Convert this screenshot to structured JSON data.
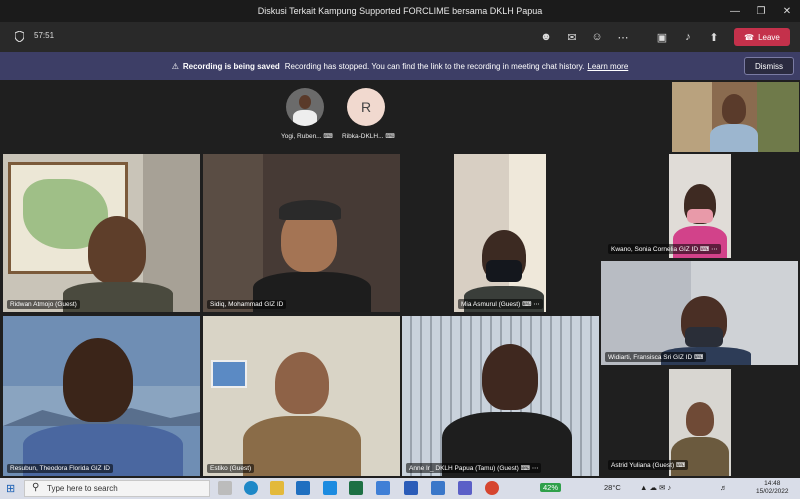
{
  "window": {
    "title": "Diskusi Terkait Kampung Supported FORCLIME bersama DKLH Papua"
  },
  "toolbar": {
    "timer": "57:51",
    "leave_label": "Leave"
  },
  "banner": {
    "bold": "Recording is being saved",
    "message": "Recording has stopped. You can find the link to the recording in meeting chat history.",
    "link": "Learn more",
    "dismiss_label": "Dismiss"
  },
  "avatars": [
    {
      "name": "Yogi, Ruben...",
      "initial": ""
    },
    {
      "name": "Ribka-DKLH...",
      "initial": "R"
    }
  ],
  "participants": {
    "ridwan": "Ridwan Atmojo (Guest)",
    "sidiq": "Sidiq, Mohammad GIZ ID",
    "mia": "Mia Asmurul (Guest)",
    "kwano": "Kwano, Sonia Cornelia GIZ ID",
    "widiarti": "Widiarti, Fransisca Sri GIZ ID",
    "resubun": "Resubun, Theodora Florida GIZ ID",
    "estiko": "Estiko (Guest)",
    "anne": "Anne Ir_ DKLH Papua (Tamu) (Guest)",
    "astrid": "Astrid Yuliana (Guest)"
  },
  "taskbar": {
    "search_placeholder": "Type here to search",
    "battery": "42%",
    "temperature": "28°C",
    "time": "14:48",
    "date": "15/02/2022"
  }
}
